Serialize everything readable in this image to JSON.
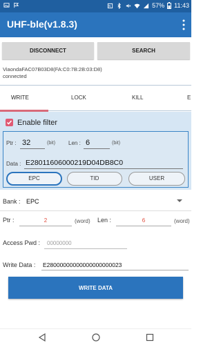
{
  "status_bar": {
    "battery": "57%",
    "time": "11:43"
  },
  "app": {
    "title": "UHF-ble(v1.8.3)"
  },
  "toolbar": {
    "disconnect_label": "DISCONNECT",
    "search_label": "SEARCH"
  },
  "device": {
    "name": "ViaondaFAC07B03D8(FA:C0:7B:2B:03:D8)",
    "status": "connected"
  },
  "tabs": [
    {
      "label": "WRITE",
      "active": true
    },
    {
      "label": "LOCK"
    },
    {
      "label": "KILL"
    },
    {
      "label": "E"
    }
  ],
  "filter": {
    "enable_label": "Enable filter",
    "enabled": true,
    "ptr_label": "Ptr :",
    "ptr_value": "32",
    "ptr_unit": "(bit)",
    "len_label": "Len :",
    "len_value": "6",
    "len_unit": "(bit)",
    "data_label": "Data :",
    "data_value": "E28011606000219D04DB8C0",
    "segments": [
      "EPC",
      "TID",
      "USER"
    ],
    "selected_segment": "EPC"
  },
  "write_form": {
    "bank_label": "Bank :",
    "bank_value": "EPC",
    "ptr_label": "Ptr :",
    "ptr_value": "2",
    "ptr_unit": "(word)",
    "len_label": "Len :",
    "len_value": "6",
    "len_unit": "(word)",
    "access_label": "Access Pwd :",
    "access_placeholder": "00000000",
    "write_data_label": "Write Data :",
    "write_data_value": "E28000000000000000000023"
  },
  "actions": {
    "write_label": "WRITE DATA"
  },
  "colors": {
    "app_bar": "#2b74bd",
    "status_bar": "#1f5fa0",
    "accent": "#e05a73",
    "value_red": "#e04b3c",
    "filter_bg": "#d6e6f4"
  }
}
